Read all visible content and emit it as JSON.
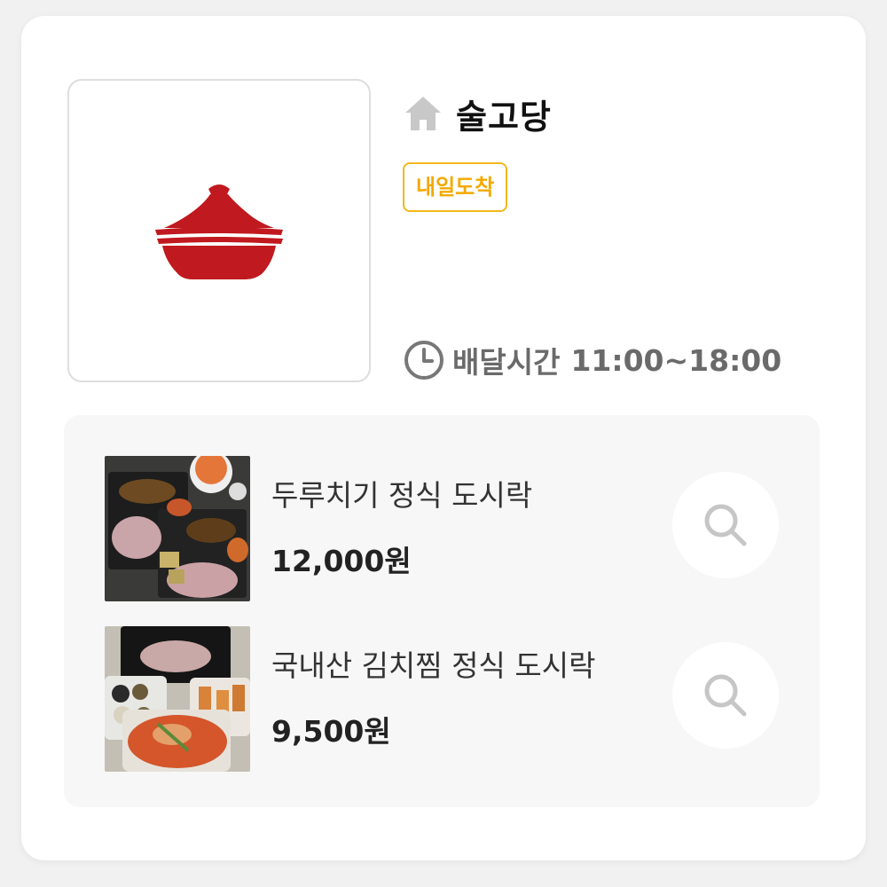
{
  "store": {
    "name": "술고당",
    "badge": "내일도착",
    "delivery_label": "배달시간",
    "delivery_hours": "11:00~18:00",
    "logo_icon": "clay-pot-icon",
    "home_icon": "home-icon",
    "clock_icon": "clock-icon"
  },
  "colors": {
    "badge_accent": "#f2b81c",
    "logo_red": "#c0191f",
    "icon_gray": "#c8c8c8"
  },
  "menu": {
    "items": [
      {
        "name": "두루치기 정식 도시락",
        "price": "12,000원",
        "action_icon": "search-icon"
      },
      {
        "name": "국내산 김치찜 정식 도시락",
        "price": "9,500원",
        "action_icon": "search-icon"
      }
    ]
  }
}
